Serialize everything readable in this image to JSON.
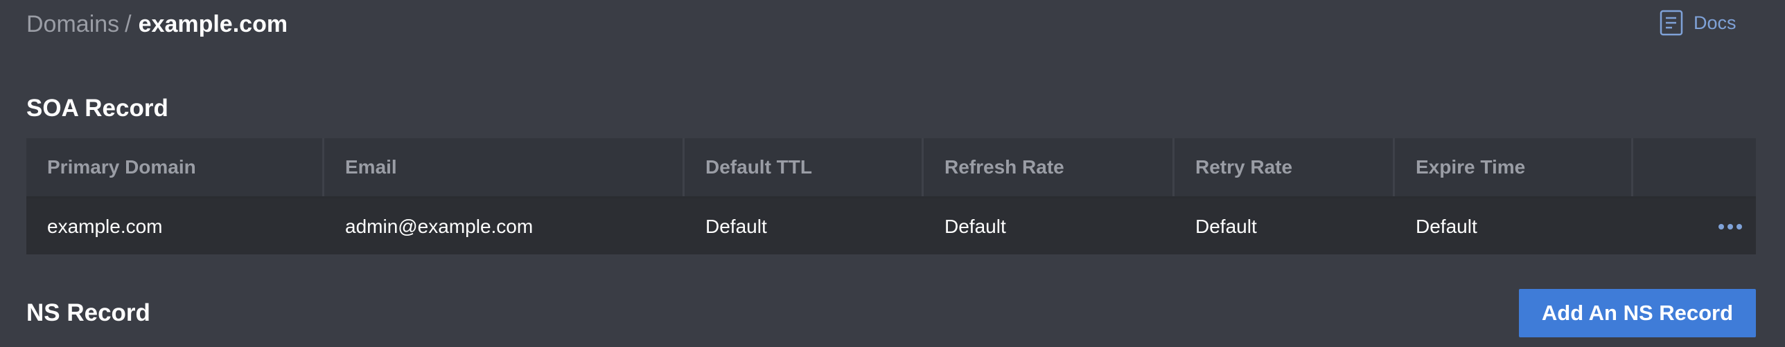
{
  "breadcrumb": {
    "parent": "Domains",
    "separator": "/",
    "current": "example.com"
  },
  "docs": {
    "label": "Docs",
    "icon": "document-icon"
  },
  "soa_section": {
    "title": "SOA Record",
    "columns": [
      "Primary Domain",
      "Email",
      "Default TTL",
      "Refresh Rate",
      "Retry Rate",
      "Expire Time"
    ],
    "rows": [
      {
        "primary_domain": "example.com",
        "email": "admin@example.com",
        "default_ttl": "Default",
        "refresh_rate": "Default",
        "retry_rate": "Default",
        "expire_time": "Default",
        "actions_icon": "more-horizontal-icon"
      }
    ]
  },
  "ns_section": {
    "title": "NS Record",
    "add_button_label": "Add An NS Record"
  },
  "colors": {
    "background": "#3a3d45",
    "accent": "#3f7cd8",
    "link": "#7fa2d8",
    "muted_text": "#9a9da5",
    "table_header_bg": "#32353c",
    "table_row_bg": "#2c2e33"
  }
}
